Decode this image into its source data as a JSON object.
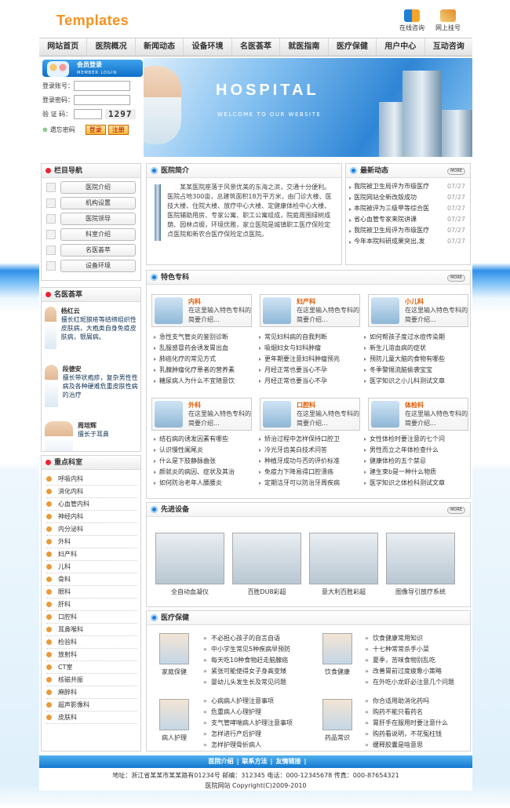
{
  "header": {
    "logo": "Templates",
    "consult": "在线咨询",
    "register": "网上挂号"
  },
  "nav": [
    "网站首页",
    "医院概况",
    "新闻动态",
    "设备环境",
    "名医荟萃",
    "就医指南",
    "医疗保健",
    "用户中心",
    "互动咨询"
  ],
  "login": {
    "title": "会员登录",
    "subtitle": "MEMBER LOGIN",
    "account": "登录账号：",
    "password": "登录密码：",
    "captcha": "验 证 码：",
    "captcha_value": "1297",
    "forgot": "遗忘密码",
    "login_btn": "登录",
    "reg_btn": "注册"
  },
  "banner": {
    "title": "HOSPITAL",
    "subtitle": "WELCOME TO OUR WEBSITE"
  },
  "column_nav": {
    "title": "栏目导航",
    "items": [
      "医院介绍",
      "机构设置",
      "医院领导",
      "科室介绍",
      "名医荟萃",
      "设备环境"
    ]
  },
  "doctors": {
    "title": "名医荟萃",
    "items": [
      {
        "name": "杨红云",
        "desc": "擅长红斑狼疮等结缔组织性皮肤病，大疱类自身免疫皮肤病，银屑病。"
      },
      {
        "name": "段德安",
        "desc": "擅长带状疱疹，复杂男性性病及各种硬难危重皮肤性病的治疗"
      },
      {
        "name": "周培辉",
        "desc": "擅长于耳鼻"
      }
    ]
  },
  "departments": {
    "title": "重点科室",
    "items": [
      "呼吸内科",
      "消化内科",
      "心血管内科",
      "神经内科",
      "内分泌科",
      "外科",
      "妇产科",
      "儿科",
      "骨科",
      "眼科",
      "肝科",
      "口腔科",
      "耳鼻喉科",
      "检验科",
      "放射科",
      "CT室",
      "核磁共振",
      "麻醉科",
      "超声影像科",
      "皮肤科"
    ]
  },
  "intro": {
    "title": "医院简介",
    "text": "某某医院座落于风景优美的东海之滨，交通十分便利。医院占地300亩，总建筑面积18万平方米，由门诊大楼、医技大楼、住院大楼、放疗中心大楼、定健康体检中心大楼、医院辅助用房、专家公寓、职工公寓组成，院庭周围绿树成荫、园林点缀，环境优雅，家立医院是城镇职工医疗保险定点医院和新农合医疗保险定点医院。"
  },
  "news": {
    "title": "最新动态",
    "items": [
      {
        "t": "我院被卫生局评为市级医疗",
        "d": "07/27"
      },
      {
        "t": "医院网站全新改版成功",
        "d": "07/27"
      },
      {
        "t": "本院被评为三级甲等综合医",
        "d": "07/27"
      },
      {
        "t": "省心血管专家来院讲课",
        "d": "07/27"
      },
      {
        "t": "我院被卫生局评为市级医疗",
        "d": "07/27"
      },
      {
        "t": "今年本院科研成果突出,发",
        "d": "07/27"
      }
    ]
  },
  "specialty": {
    "title": "特色专科",
    "cards": [
      {
        "name": "内科",
        "desc": "在这里输入特色专科的简要介绍..."
      },
      {
        "name": "妇产科",
        "desc": "在这里输入特色专科的简要介绍..."
      },
      {
        "name": "小儿科",
        "desc": "在这里输入特色专科的简要介绍..."
      },
      {
        "name": "外科",
        "desc": "在这里输入特色专科的简要介绍..."
      },
      {
        "name": "口腔科",
        "desc": "在这里输入特色专科的简要介绍..."
      },
      {
        "name": "体检科",
        "desc": "在这里输入特色专科的简要介绍..."
      }
    ],
    "links1": [
      "急性支气管炎的鉴别诊断",
      "常见妇科病的自我判断",
      "如何帮孩子度过水痘传染期",
      "乱服感冒药会诱发胃出血",
      "吸烟妇女与妇科肿瘤",
      "新生儿溶血病的症状",
      "肺癌化疗的常见方式",
      "更年期要注意妇科肿瘤预兆",
      "预防儿童大脑的食物有哪些",
      "乳腺肿瘤化疗患者的营养素",
      "月经正常也要当心不孕",
      "冬季警惕流脑偷袭宝宝",
      "糖尿病人为什么不宜随意饮",
      "月经正常也要当心不孕",
      "医学知识之小儿科测试文章"
    ],
    "links2": [
      "结石病的诱发因素有哪些",
      "矫治过程中怎样保持口腔卫",
      "女性体检时要注意的七个问",
      "认识慢性阑尾炎",
      "冷光牙齿美白技术问答",
      "男性而立之年体检查什么",
      "什么是下肢静脉曲张",
      "种植牙成功与否的评价标准",
      "健康体检的五个禁忌",
      "颜就炎的病因、症状及其治",
      "免疫力下降易得口腔溃疡",
      "建生束b是一种什么物质",
      "如何防治老年人腰腰炎",
      "定期洁牙可以防治牙周疾病",
      "医学知识之体检科测试文章"
    ]
  },
  "equipment": {
    "title": "先进设备",
    "items": [
      "全自动血凝仪",
      "百胜DU8彩超",
      "意大利百胜彩超",
      "图像导引放疗系统"
    ]
  },
  "care": {
    "title": "医疗保健",
    "groups": [
      {
        "label": "家庭保健",
        "items": [
          "不必担心孩子的自言自语",
          "中小学生常见5种疾病早预防",
          "每天吃10种食物赶走脑腺癌",
          "紧张可能使得女子身高变矮",
          "婴幼儿头发生长及常见问题"
        ]
      },
      {
        "label": "饮食健康",
        "items": [
          "饮食健康常用知识",
          "十七种常常杀手小菜",
          "夏季，苦味食物别乱吃",
          "改善胃前过度疲惫小策略",
          "在外吃小龙虾必注意几个问题"
        ]
      },
      {
        "label": "病人护理",
        "items": [
          "心病病人护理注意事项",
          "危重病人心理护理",
          "支气管哮喘病人护理注意事项",
          "怎样进行产后护理",
          "怎样护理骨折病人"
        ]
      },
      {
        "label": "药品常识",
        "items": [
          "你合适用助消化药吗",
          "购药不能只看药名",
          "胃肝手在服用时要注意什么",
          "购药看说明，不花冤枉钱",
          "缓释胶囊是啥意思"
        ]
      }
    ]
  },
  "more": "MORE",
  "footer": {
    "links": [
      "医院介绍",
      "联系方法",
      "友情链接"
    ],
    "address": "地址：浙江省某某市某某路有01234号  邮编：312345  电话：000-12345678  传真：000-87654321",
    "copyright": "医院网站  Copyright(C)2009-2010"
  }
}
